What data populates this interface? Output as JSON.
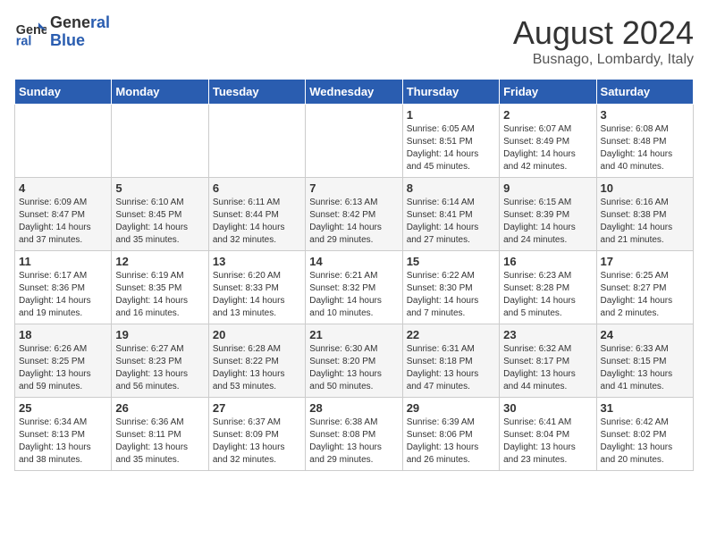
{
  "logo": {
    "line1": "General",
    "line2": "Blue"
  },
  "title": "August 2024",
  "location": "Busnago, Lombardy, Italy",
  "days_of_week": [
    "Sunday",
    "Monday",
    "Tuesday",
    "Wednesday",
    "Thursday",
    "Friday",
    "Saturday"
  ],
  "weeks": [
    [
      {
        "day": "",
        "info": ""
      },
      {
        "day": "",
        "info": ""
      },
      {
        "day": "",
        "info": ""
      },
      {
        "day": "",
        "info": ""
      },
      {
        "day": "1",
        "info": "Sunrise: 6:05 AM\nSunset: 8:51 PM\nDaylight: 14 hours and 45 minutes."
      },
      {
        "day": "2",
        "info": "Sunrise: 6:07 AM\nSunset: 8:49 PM\nDaylight: 14 hours and 42 minutes."
      },
      {
        "day": "3",
        "info": "Sunrise: 6:08 AM\nSunset: 8:48 PM\nDaylight: 14 hours and 40 minutes."
      }
    ],
    [
      {
        "day": "4",
        "info": "Sunrise: 6:09 AM\nSunset: 8:47 PM\nDaylight: 14 hours and 37 minutes."
      },
      {
        "day": "5",
        "info": "Sunrise: 6:10 AM\nSunset: 8:45 PM\nDaylight: 14 hours and 35 minutes."
      },
      {
        "day": "6",
        "info": "Sunrise: 6:11 AM\nSunset: 8:44 PM\nDaylight: 14 hours and 32 minutes."
      },
      {
        "day": "7",
        "info": "Sunrise: 6:13 AM\nSunset: 8:42 PM\nDaylight: 14 hours and 29 minutes."
      },
      {
        "day": "8",
        "info": "Sunrise: 6:14 AM\nSunset: 8:41 PM\nDaylight: 14 hours and 27 minutes."
      },
      {
        "day": "9",
        "info": "Sunrise: 6:15 AM\nSunset: 8:39 PM\nDaylight: 14 hours and 24 minutes."
      },
      {
        "day": "10",
        "info": "Sunrise: 6:16 AM\nSunset: 8:38 PM\nDaylight: 14 hours and 21 minutes."
      }
    ],
    [
      {
        "day": "11",
        "info": "Sunrise: 6:17 AM\nSunset: 8:36 PM\nDaylight: 14 hours and 19 minutes."
      },
      {
        "day": "12",
        "info": "Sunrise: 6:19 AM\nSunset: 8:35 PM\nDaylight: 14 hours and 16 minutes."
      },
      {
        "day": "13",
        "info": "Sunrise: 6:20 AM\nSunset: 8:33 PM\nDaylight: 14 hours and 13 minutes."
      },
      {
        "day": "14",
        "info": "Sunrise: 6:21 AM\nSunset: 8:32 PM\nDaylight: 14 hours and 10 minutes."
      },
      {
        "day": "15",
        "info": "Sunrise: 6:22 AM\nSunset: 8:30 PM\nDaylight: 14 hours and 7 minutes."
      },
      {
        "day": "16",
        "info": "Sunrise: 6:23 AM\nSunset: 8:28 PM\nDaylight: 14 hours and 5 minutes."
      },
      {
        "day": "17",
        "info": "Sunrise: 6:25 AM\nSunset: 8:27 PM\nDaylight: 14 hours and 2 minutes."
      }
    ],
    [
      {
        "day": "18",
        "info": "Sunrise: 6:26 AM\nSunset: 8:25 PM\nDaylight: 13 hours and 59 minutes."
      },
      {
        "day": "19",
        "info": "Sunrise: 6:27 AM\nSunset: 8:23 PM\nDaylight: 13 hours and 56 minutes."
      },
      {
        "day": "20",
        "info": "Sunrise: 6:28 AM\nSunset: 8:22 PM\nDaylight: 13 hours and 53 minutes."
      },
      {
        "day": "21",
        "info": "Sunrise: 6:30 AM\nSunset: 8:20 PM\nDaylight: 13 hours and 50 minutes."
      },
      {
        "day": "22",
        "info": "Sunrise: 6:31 AM\nSunset: 8:18 PM\nDaylight: 13 hours and 47 minutes."
      },
      {
        "day": "23",
        "info": "Sunrise: 6:32 AM\nSunset: 8:17 PM\nDaylight: 13 hours and 44 minutes."
      },
      {
        "day": "24",
        "info": "Sunrise: 6:33 AM\nSunset: 8:15 PM\nDaylight: 13 hours and 41 minutes."
      }
    ],
    [
      {
        "day": "25",
        "info": "Sunrise: 6:34 AM\nSunset: 8:13 PM\nDaylight: 13 hours and 38 minutes."
      },
      {
        "day": "26",
        "info": "Sunrise: 6:36 AM\nSunset: 8:11 PM\nDaylight: 13 hours and 35 minutes."
      },
      {
        "day": "27",
        "info": "Sunrise: 6:37 AM\nSunset: 8:09 PM\nDaylight: 13 hours and 32 minutes."
      },
      {
        "day": "28",
        "info": "Sunrise: 6:38 AM\nSunset: 8:08 PM\nDaylight: 13 hours and 29 minutes."
      },
      {
        "day": "29",
        "info": "Sunrise: 6:39 AM\nSunset: 8:06 PM\nDaylight: 13 hours and 26 minutes."
      },
      {
        "day": "30",
        "info": "Sunrise: 6:41 AM\nSunset: 8:04 PM\nDaylight: 13 hours and 23 minutes."
      },
      {
        "day": "31",
        "info": "Sunrise: 6:42 AM\nSunset: 8:02 PM\nDaylight: 13 hours and 20 minutes."
      }
    ]
  ]
}
